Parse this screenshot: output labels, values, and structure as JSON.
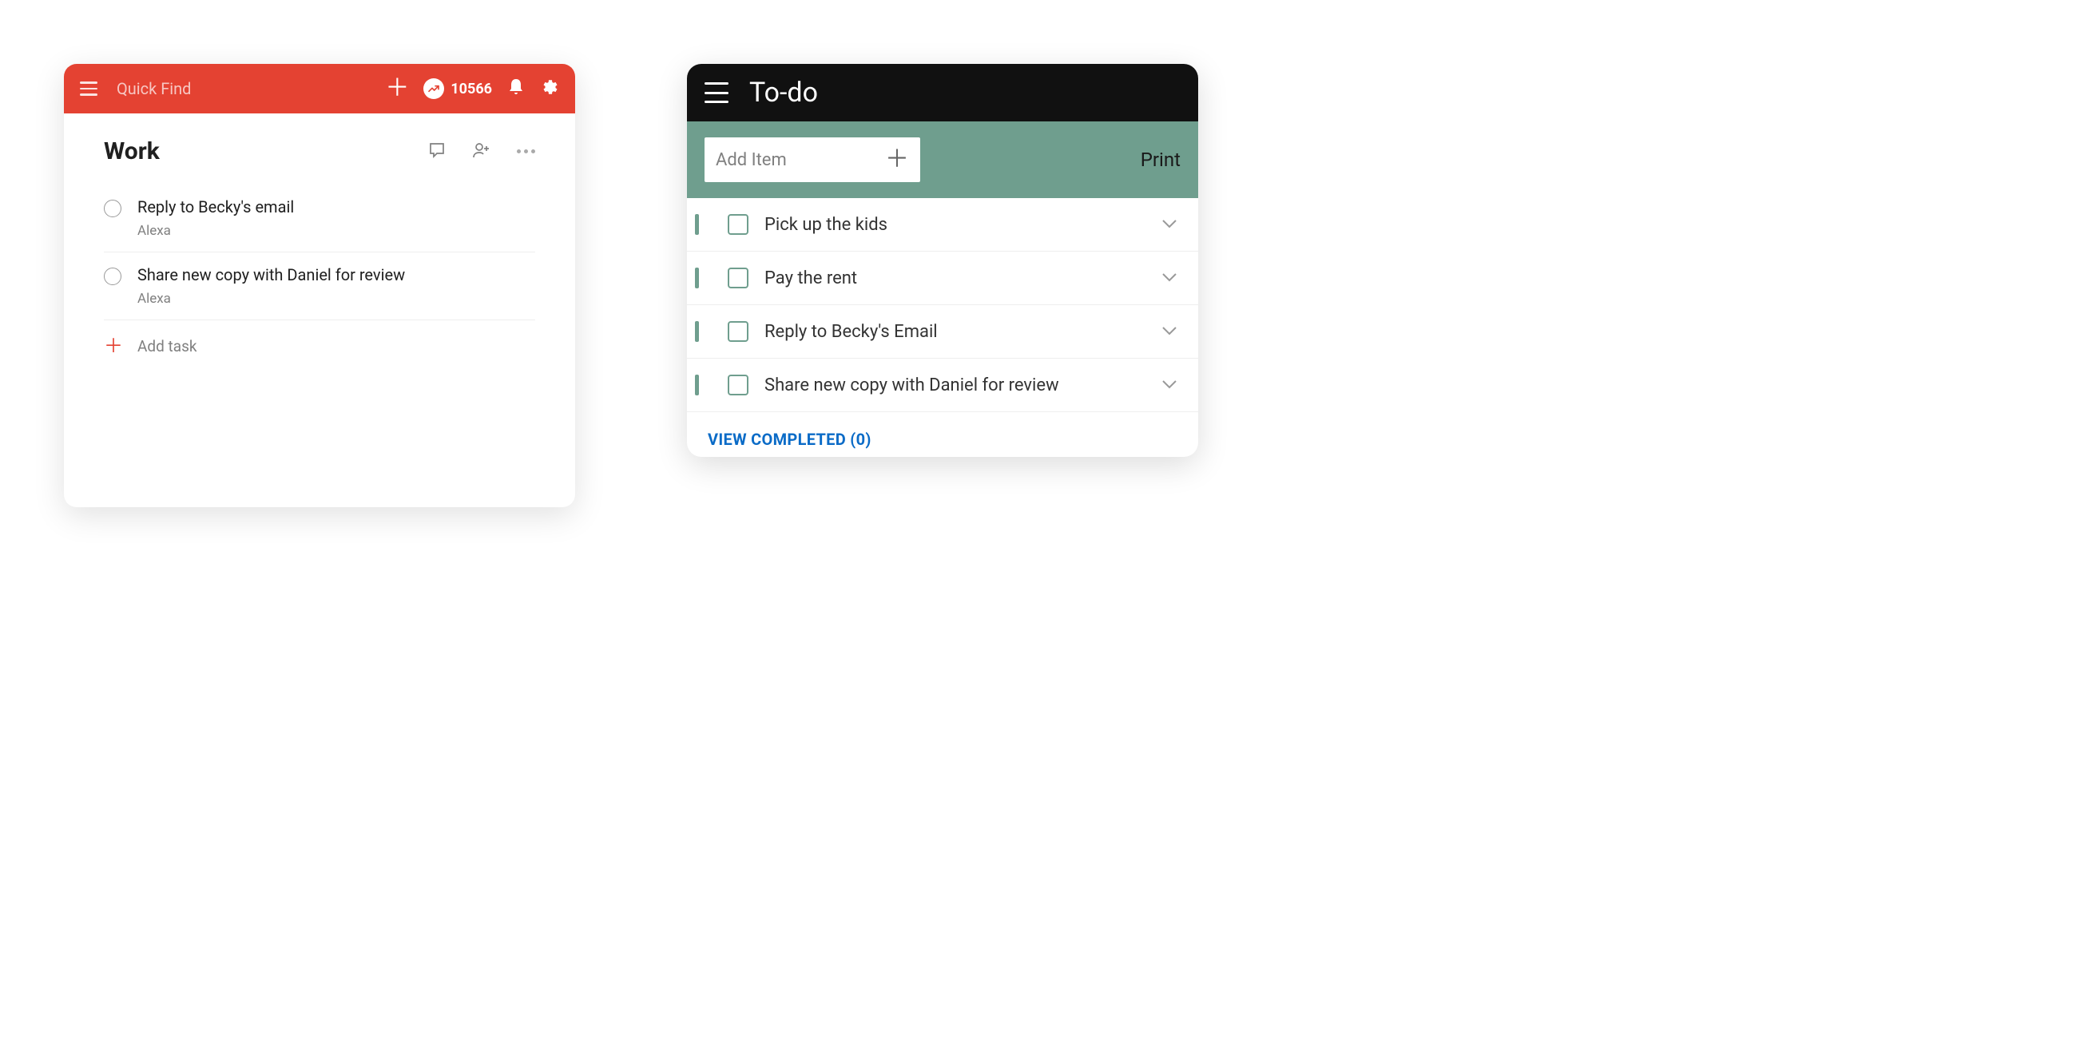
{
  "left": {
    "header": {
      "quick_find_placeholder": "Quick Find",
      "karma_count": "10566"
    },
    "title": "Work",
    "tasks": [
      {
        "title": "Reply to Becky's email",
        "sub": "Alexa"
      },
      {
        "title": "Share new copy with Daniel for review",
        "sub": "Alexa"
      }
    ],
    "add_task_label": "Add task"
  },
  "right": {
    "title": "To-do",
    "add_item_placeholder": "Add Item",
    "print_label": "Print",
    "items": [
      {
        "text": "Pick up the kids"
      },
      {
        "text": "Pay the rent"
      },
      {
        "text": "Reply to Becky's Email"
      },
      {
        "text": "Share new copy with Daniel for review"
      }
    ],
    "view_completed_label": "VIEW COMPLETED (0)"
  }
}
